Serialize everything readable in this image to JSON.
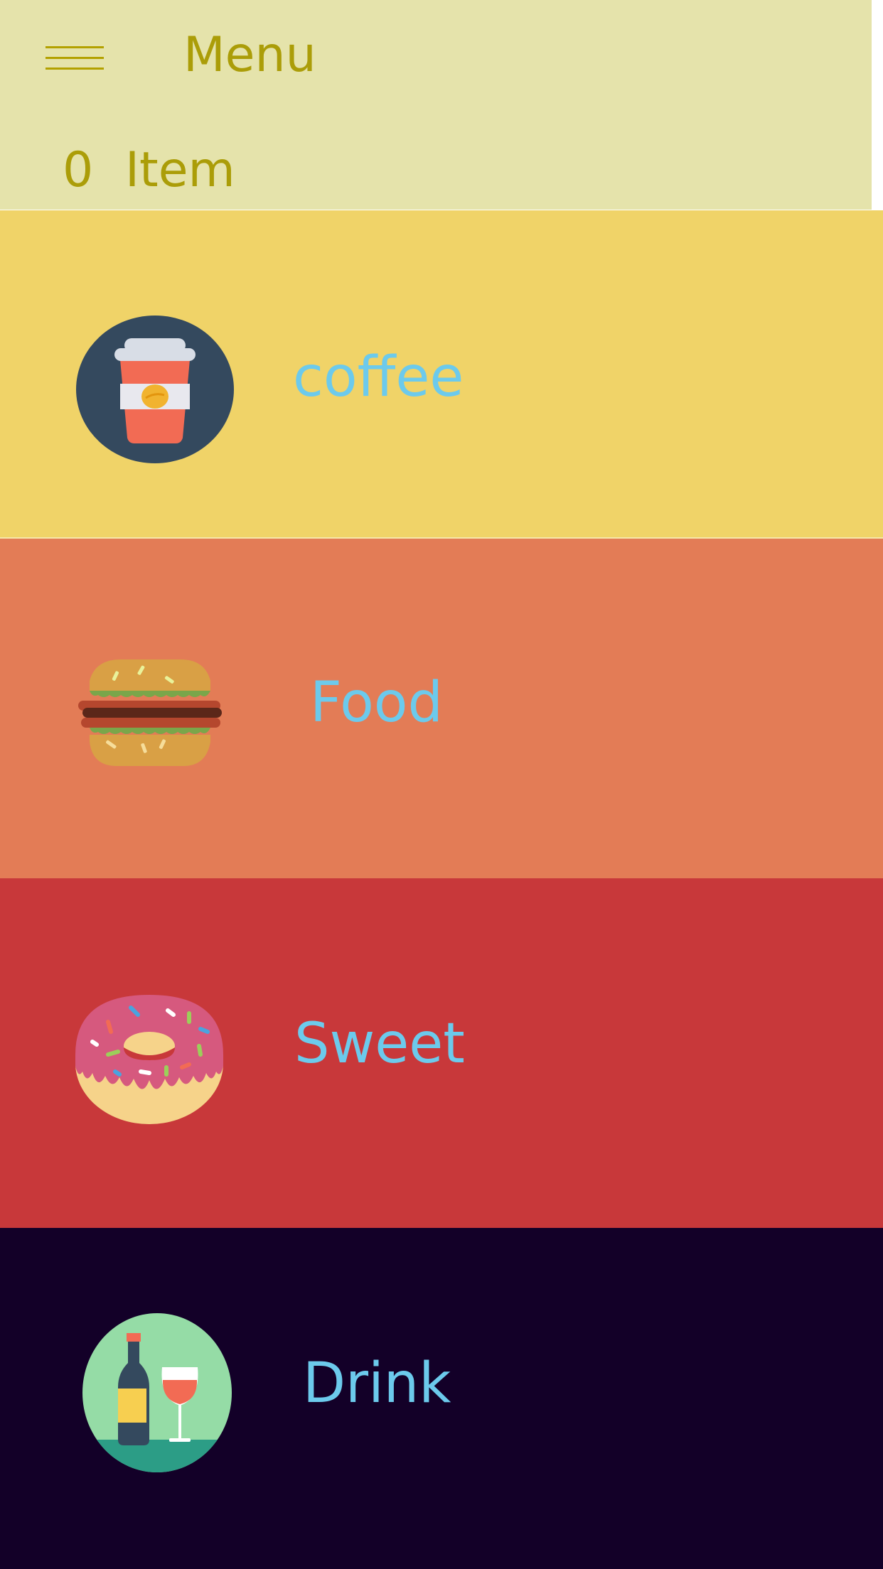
{
  "header": {
    "title": "Menu",
    "cart_count": "0",
    "cart_label": "Item",
    "menu_icon": "hamburger-icon"
  },
  "categories": [
    {
      "id": "coffee",
      "label": "coffee",
      "icon": "coffee-cup-icon",
      "background": "#f0d368"
    },
    {
      "id": "food",
      "label": "Food",
      "icon": "burger-icon",
      "background": "#e37c56"
    },
    {
      "id": "sweet",
      "label": "Sweet",
      "icon": "donut-icon",
      "background": "#c8383a"
    },
    {
      "id": "drink",
      "label": "Drink",
      "icon": "wine-bottle-glass-icon",
      "background": "#130028"
    }
  ],
  "colors": {
    "header_bg": "#e5e3ab",
    "header_text": "#ab9d08",
    "category_text": "#6ccaec"
  }
}
